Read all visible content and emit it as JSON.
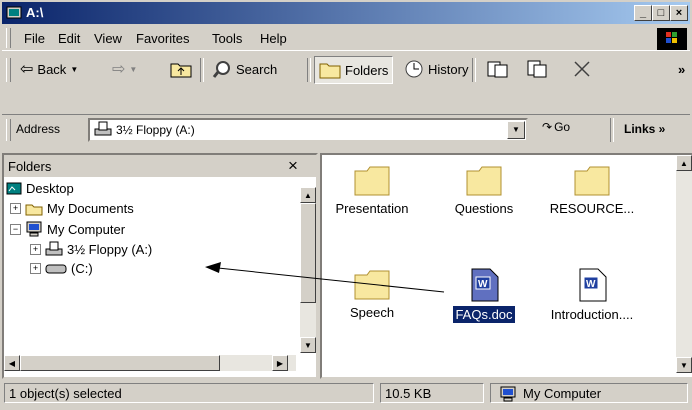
{
  "window": {
    "title": "A:\\",
    "controls": [
      "minimize",
      "maximize",
      "close"
    ]
  },
  "menu": {
    "items": [
      "File",
      "Edit",
      "View",
      "Favorites",
      "Tools",
      "Help"
    ]
  },
  "toolbar": {
    "back_label": "Back",
    "search_label": "Search",
    "folders_label": "Folders",
    "history_label": "History",
    "more": "»"
  },
  "address": {
    "label": "Address",
    "value": "3½ Floppy (A:)",
    "go_label": "Go",
    "links_label": "Links »"
  },
  "folders_pane": {
    "title": "Folders",
    "close": "×",
    "tree": [
      {
        "label": "Desktop",
        "icon": "desktop-icon"
      },
      {
        "label": "My Documents",
        "icon": "my-documents-icon",
        "expander": "+"
      },
      {
        "label": "My Computer",
        "icon": "my-computer-icon",
        "expander": "−"
      },
      {
        "label": "3½ Floppy (A:)",
        "icon": "floppy-icon",
        "expander": "+"
      },
      {
        "label": "(C:)",
        "icon": "hard-drive-icon",
        "expander": "+"
      }
    ]
  },
  "files": [
    {
      "label": "Presentation",
      "type": "folder"
    },
    {
      "label": "Questions",
      "type": "folder"
    },
    {
      "label": "RESOURCE...",
      "type": "folder"
    },
    {
      "label": "Speech",
      "type": "folder"
    },
    {
      "label": "FAQs.doc",
      "type": "word-doc",
      "selected": true
    },
    {
      "label": "Introduction....",
      "type": "word-doc"
    }
  ],
  "status": {
    "selection": "1 object(s) selected",
    "size": "10.5 KB",
    "location": "My Computer"
  },
  "colors": {
    "title_active": "#0a246a",
    "face": "#d4d0c8",
    "folder": "#f8e8a0",
    "selection": "#0a246a"
  }
}
